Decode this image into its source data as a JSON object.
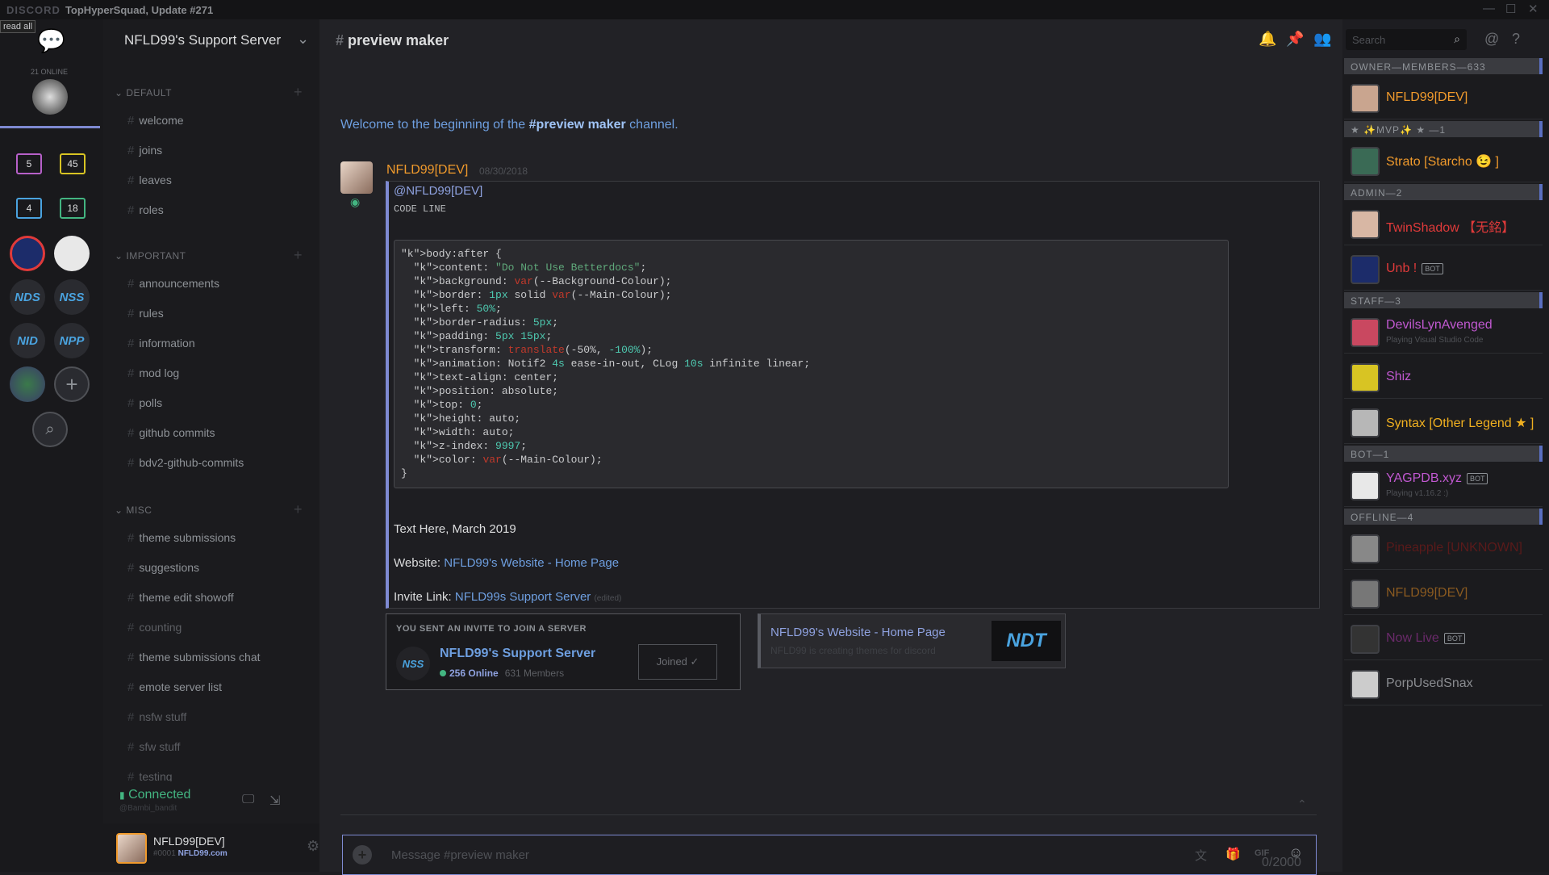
{
  "titlebar": {
    "brand": "DISCORD",
    "title": "TopHyperSquad, Update #271"
  },
  "read_all": "read all",
  "guilds": {
    "online_count": "21 ONLINE",
    "folders": [
      {
        "count": "5",
        "color": "#b760c9"
      },
      {
        "count": "45",
        "color": "#d8c423"
      },
      {
        "count": "4",
        "color": "#4aa3df"
      },
      {
        "count": "18",
        "color": "#43b581"
      }
    ],
    "servers": [
      "NDS",
      "NSS",
      "NID",
      "NPP"
    ],
    "add_icon": "plus-icon",
    "search_icon": "search-icon"
  },
  "server": {
    "name": "NFLD99's Support Server"
  },
  "categories": [
    {
      "name": "DEFAULT",
      "channels": [
        "welcome",
        "joins",
        "leaves",
        "roles"
      ]
    },
    {
      "name": "IMPORTANT",
      "channels": [
        "announcements",
        "rules",
        "information",
        "mod log",
        "polls",
        "github commits",
        "bdv2-github-commits"
      ]
    },
    {
      "name": "MISC",
      "channels": [
        "theme submissions",
        "suggestions",
        "theme edit showoff",
        "counting",
        "theme submissions chat",
        "emote server list",
        "nsfw stuff",
        "sfw stuff",
        "testing"
      ]
    }
  ],
  "connection": {
    "status": "Connected",
    "sub": "@Bambi_bandit"
  },
  "user": {
    "name": "NFLD99[DEV]",
    "tag": "#0001",
    "status": "NFLD99.com"
  },
  "channel": {
    "title": "preview maker",
    "welcome_prefix": "Welcome to the beginning of the ",
    "welcome_channel": "#preview maker",
    "welcome_suffix": " channel."
  },
  "search": {
    "placeholder": "Search"
  },
  "message": {
    "author": "NFLD99[DEV]",
    "timestamp": "08/30/2018",
    "mention": "@NFLD99[DEV]",
    "code_label": "CODE LINE",
    "text_here": "Text Here, March 2019",
    "website_label": "Website: ",
    "website_link": "NFLD99's Website - Home Page",
    "invite_label": "Invite Link: ",
    "invite_link": "NFLD99s Support Server",
    "edited": "(edited)"
  },
  "invite": {
    "label": "YOU SENT AN INVITE TO JOIN A SERVER",
    "icon_text": "NSS",
    "server": "NFLD99's Support Server",
    "online": "256 Online",
    "members": "631 Members",
    "button": "Joined ✓"
  },
  "link_embed": {
    "title": "NFLD99's Website - Home Page",
    "desc": "NFLD99 is creating themes for discord",
    "thumb": "NDT"
  },
  "composer": {
    "placeholder": "Message #preview maker",
    "char_count": "0/2000"
  },
  "member_groups": [
    {
      "header": "OWNER—MEMBERS—633",
      "members": [
        {
          "name": "NFLD99[DEV]",
          "color": "#f09a2c",
          "avatar": "#c9a58f"
        }
      ]
    },
    {
      "header": "★ ✨MVP✨ ★ —1",
      "members": [
        {
          "name": "Strato [Starcho 😉 ]",
          "color": "#f09a2c",
          "avatar": "#3a6a55"
        }
      ]
    },
    {
      "header": "ADMIN—2",
      "members": [
        {
          "name": "TwinShadow 【无銘】",
          "color": "#e03a3a",
          "avatar": "#d8b7a4"
        },
        {
          "name": "Unb !",
          "color": "#e03a3a",
          "avatar": "#1c2c6a",
          "bot": "BOT"
        }
      ]
    },
    {
      "header": "STAFF—3",
      "members": [
        {
          "name": "DevilsLynAvenged",
          "color": "#c058d0",
          "avatar": "#c94860",
          "sub": "Playing Visual Studio Code"
        },
        {
          "name": "Shiz",
          "color": "#c058d0",
          "avatar": "#d8c423"
        },
        {
          "name": "Syntax [Other Legend ★ ]",
          "color": "#f0b020",
          "avatar": "#b7b7b7"
        }
      ]
    },
    {
      "header": "BOT—1",
      "members": [
        {
          "name": "YAGPDB.xyz",
          "color": "#c058d0",
          "avatar": "#e8e8e8",
          "bot": "BOT",
          "sub": "Playing v1.16.2 :)"
        }
      ]
    },
    {
      "header": "OFFLINE—4",
      "members": [
        {
          "name": "Pineapple [UNKNOWN]",
          "color": "#5a1a1a",
          "avatar": "#888888"
        },
        {
          "name": "NFLD99[DEV]",
          "color": "#8a5a20",
          "avatar": "#777777"
        },
        {
          "name": "Now Live",
          "color": "#6a2a6a",
          "avatar": "#333333",
          "bot": "BOT"
        },
        {
          "name": "PorpUsedSnax",
          "color": "#8a8c90",
          "avatar": "#cccccc"
        }
      ]
    }
  ],
  "code_lines": [
    "body:after {",
    "  content: \"Do Not Use Betterdocs\";",
    "  background: var(--Background-Colour);",
    "  border: 1px solid var(--Main-Colour);",
    "  left: 50%;",
    "  border-radius: 5px;",
    "  padding: 5px 15px;",
    "  transform: translate(-50%, -100%);",
    "  animation: Notif2 4s ease-in-out, CLog 10s infinite linear;",
    "  text-align: center;",
    "  position: absolute;",
    "  top: 0;",
    "  height: auto;",
    "  width: auto;",
    "  z-index: 9997;",
    "  color: var(--Main-Colour);",
    "}"
  ]
}
